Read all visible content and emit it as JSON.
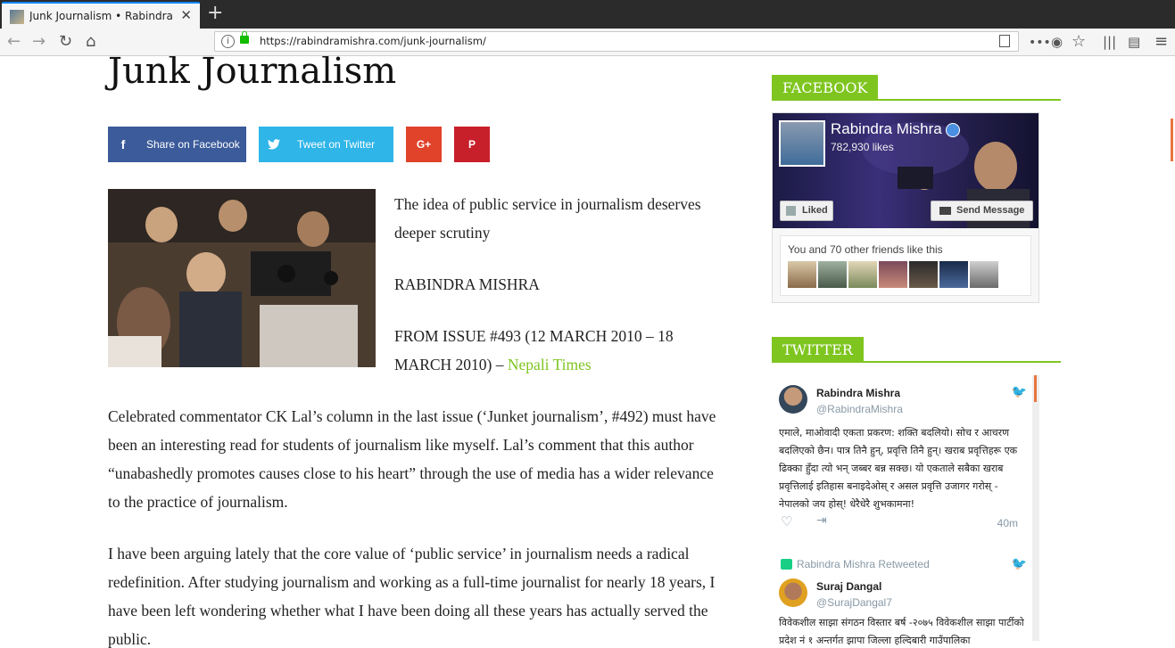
{
  "browser": {
    "tab_title": "Junk Journalism • Rabindra Mishra",
    "tab_close": "✕",
    "new_tab": "+",
    "url": "https://rabindramishra.com/junk-journalism/"
  },
  "article": {
    "title": "Junk Journalism",
    "share_facebook": "Share on Facebook",
    "share_twitter": "Tweet on Twitter",
    "share_gplus": "G+",
    "share_pinterest": "P",
    "intro_line": "The idea of public service in journalism deserves deeper scrutiny",
    "author": "RABINDRA MISHRA",
    "issue": "FROM ISSUE #493 (12 MARCH 2010 – 18 MARCH 2010) –",
    "source_link": "Nepali Times",
    "paragraph1": "Celebrated commentator CK Lal’s column in the last issue (‘Junket journalism’, #492) must have been an interesting read for students of journalism like myself. Lal’s comment that this author “unabashedly promotes causes close to his heart” through the use of media has a wider relevance to the practice of journalism.",
    "paragraph2": "I have been arguing lately that the core value of ‘public service’ in journalism needs a radical redefinition. After studying journalism and working as a full-time journalist for nearly 18 years, I have been left wondering whether what I have been doing all these years has actually served the public."
  },
  "sidebar": {
    "facebook_title": "FACEBOOK",
    "fb_page_name": "Rabindra Mishra",
    "fb_likes": "782,930 likes",
    "fb_liked_btn": "Liked",
    "fb_message_btn": "Send Message",
    "fb_friends_text": "You and 70 other friends like this",
    "twitter_title": "TWITTER",
    "tweet1": {
      "name": "Rabindra Mishra",
      "handle": "@RabindraMishra",
      "text": "एमाले, माओवादी एकता प्रकरण: शक्ति बदलियो। सोच र आचरण बदलिएको छैन। पात्र तिनै हुन्, प्रवृत्ति तिनै हुन्। खराब प्रवृत्तिहरू एक ढिक्का हुँदा त्यो भन् जब्बर बन्न सक्छ। यो एकताले सबैका खराब प्रवृत्तिलाई इतिहास बनाइदेओस् र असल प्रवृत्ति उजागर गरोस् - नेपालको जय होस्! धेरैधेरै शुभकामना!",
      "time": "40m"
    },
    "retweet_label": "Rabindra Mishra Retweeted",
    "tweet2": {
      "name": "Suraj Dangal",
      "handle": "@SurajDangal7",
      "text": "विवेकशील साझा संगठन विस्तार बर्ष -२०७५ विवेकशील साझा पार्टीको प्रदेश नं १ अन्तर्गत झापा जिल्ला हल्दिबारी गाउँपालिका"
    }
  }
}
